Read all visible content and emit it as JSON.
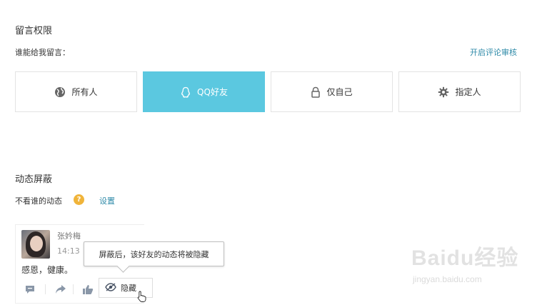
{
  "comment_permission": {
    "title": "留言权限",
    "who_label": "谁能给我留言：",
    "review_link": "开启评论审核",
    "options": [
      {
        "label": "所有人",
        "icon": "globe-icon",
        "selected": false
      },
      {
        "label": "QQ好友",
        "icon": "qq-penguin-icon",
        "selected": true
      },
      {
        "label": "仅自己",
        "icon": "lock-icon",
        "selected": false
      },
      {
        "label": "指定人",
        "icon": "gear-icon",
        "selected": false
      }
    ],
    "selected_color": "#5bc8e0"
  },
  "feed_block": {
    "title": "动态屏蔽",
    "label": "不看谁的动态",
    "help_symbol": "?",
    "settings_link": "设置"
  },
  "preview_card": {
    "user_name": "张妗梅",
    "time": "14:13",
    "content": "感恩，健康。",
    "tooltip": "屏蔽后，该好友的动态将被隐藏",
    "hide_label": "隐藏"
  },
  "watermark": {
    "brand": "Baidu经验",
    "url": "jingyan.baidu.com"
  }
}
